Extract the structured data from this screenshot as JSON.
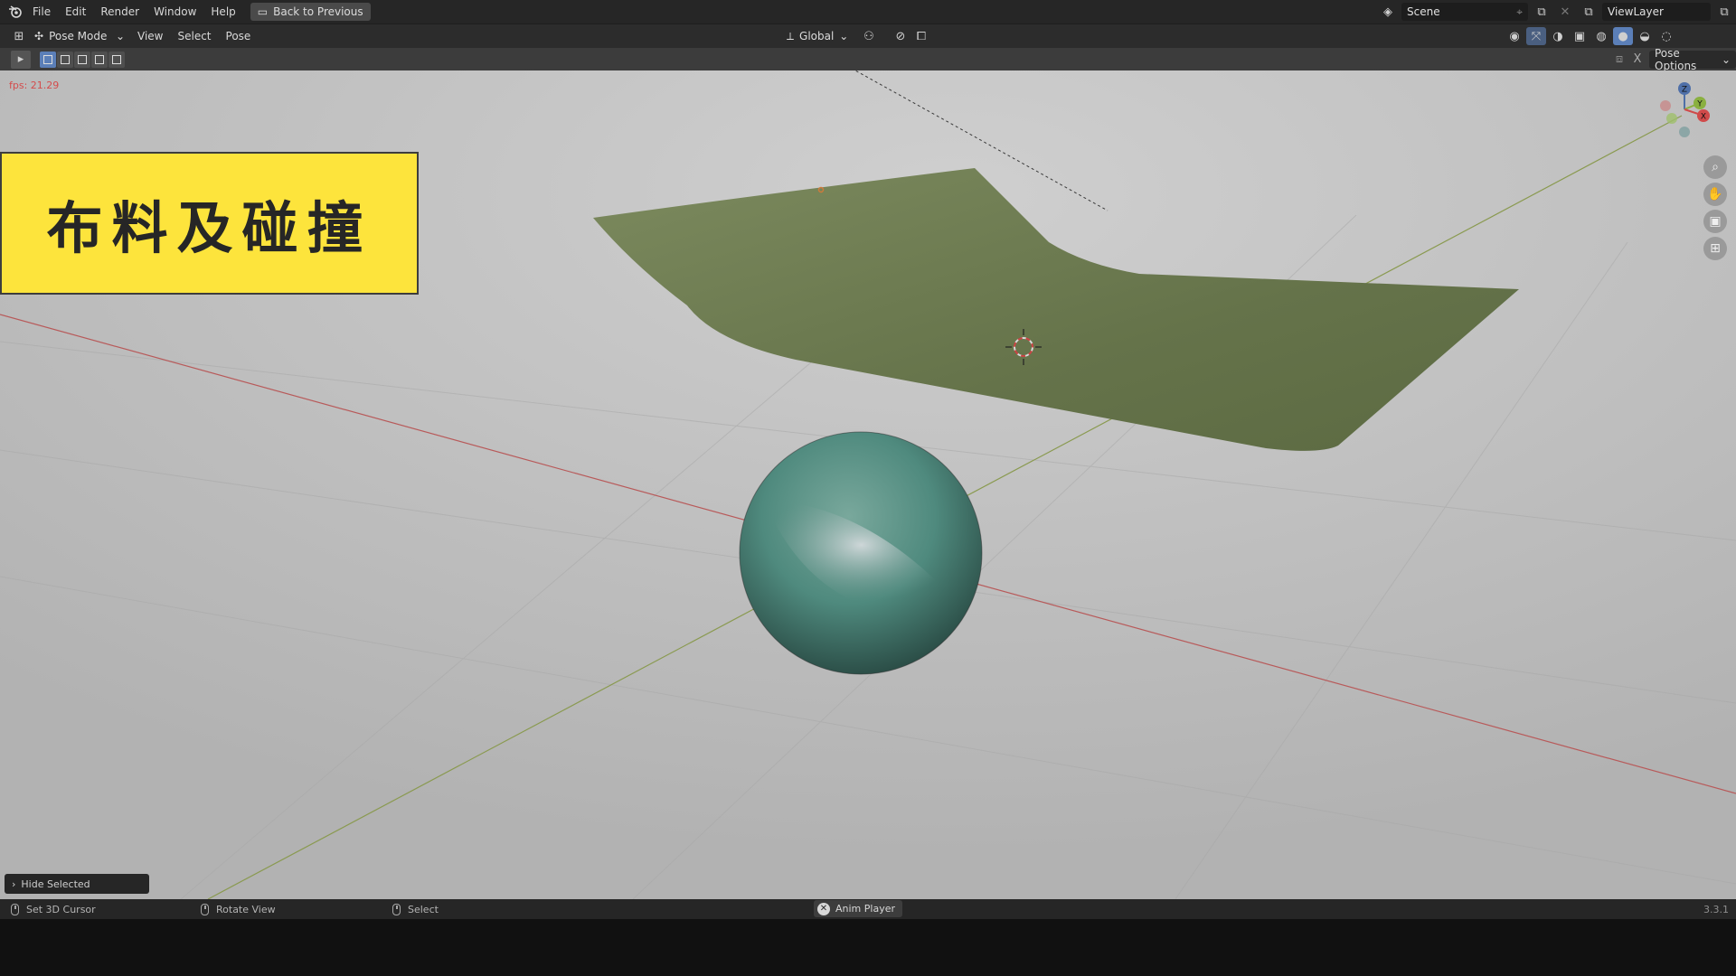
{
  "menu": {
    "items": [
      "File",
      "Edit",
      "Render",
      "Window",
      "Help"
    ],
    "back_button": "Back to Previous",
    "scene": "Scene",
    "view_layer": "ViewLayer"
  },
  "header": {
    "mode": "Pose Mode",
    "menus": [
      "View",
      "Select",
      "Pose"
    ],
    "orientation": "Global"
  },
  "toolbar": {
    "pose_options": "Pose Options"
  },
  "viewport": {
    "fps": "fps: 21.29",
    "title_card": "布料及碰撞",
    "gizmo_labels": {
      "z": "Z",
      "y": "Y",
      "x": "X"
    },
    "hide_panel": "Hide Selected"
  },
  "status": {
    "set_cursor": "Set 3D Cursor",
    "rotate_view": "Rotate View",
    "select": "Select",
    "anim_player": "Anim Player",
    "version": "3.3.1"
  },
  "colors": {
    "cloth": "#6b7a4e",
    "sphere": "#4f8a7e",
    "title_bg": "#fde43c",
    "x_axis": "#b85a5a",
    "y_axis": "#8a9a50"
  },
  "icons": {
    "blender": "blender-logo-icon",
    "crosshair": "3d-cursor-icon"
  }
}
